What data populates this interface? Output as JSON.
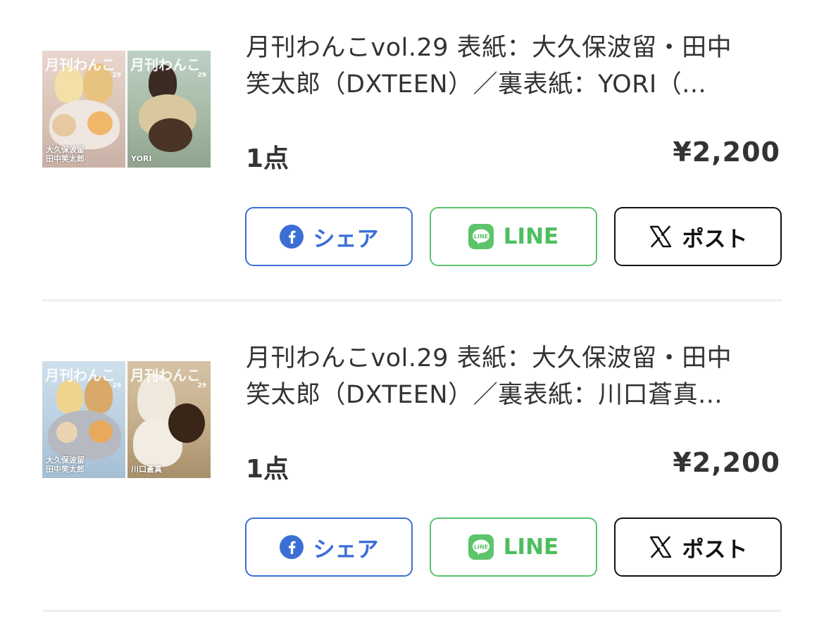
{
  "items": [
    {
      "title_line1": "月刊わんこvol.29 表紙：大久保波留・田中",
      "title_line2": "笑太郎（DXTEEN）／裏表紙：YORI（...",
      "quantity": "1点",
      "price": "¥2,200",
      "thumb": {
        "front_logo": "月刊わんこ",
        "front_vol": "29",
        "front_name": "大久保波留\n田中笑太郎",
        "back_logo": "月刊わんこ",
        "back_vol": "29",
        "back_name": "YORI"
      },
      "share": {
        "facebook_label": "シェア",
        "line_label": "LINE",
        "x_label": "ポスト"
      }
    },
    {
      "title_line1": "月刊わんこvol.29 表紙：大久保波留・田中",
      "title_line2": "笑太郎（DXTEEN）／裏表紙：川口蒼真...",
      "quantity": "1点",
      "price": "¥2,200",
      "thumb": {
        "front_logo": "月刊わんこ",
        "front_vol": "29",
        "front_name": "大久保波留\n田中笑太郎",
        "back_logo": "月刊わんこ",
        "back_vol": "29",
        "back_name": "川口蒼真"
      },
      "share": {
        "facebook_label": "シェア",
        "line_label": "LINE",
        "x_label": "ポスト"
      }
    }
  ],
  "icons": {
    "facebook": "facebook-icon",
    "line": "line-icon",
    "x": "x-logo-icon"
  },
  "colors": {
    "facebook": "#3b6fd6",
    "line": "#5cc46a",
    "x": "#111111",
    "text": "#333333",
    "divider": "#eeeeee"
  }
}
